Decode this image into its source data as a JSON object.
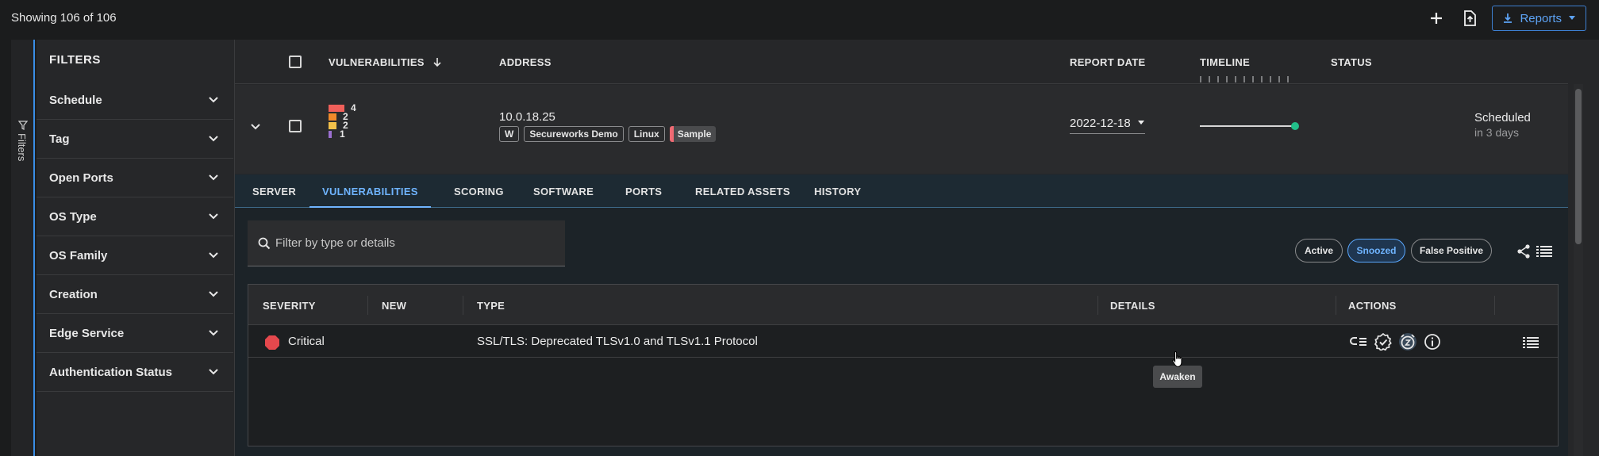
{
  "header": {
    "showing": "Showing 106 of 106",
    "reports_label": "Reports",
    "add_icon": "plus-icon",
    "upload_icon": "file-upload-icon"
  },
  "filter_rail": {
    "label": "Filters"
  },
  "filters": {
    "title": "FILTERS",
    "items": [
      {
        "label": "Schedule"
      },
      {
        "label": "Tag"
      },
      {
        "label": "Open Ports"
      },
      {
        "label": "OS Type"
      },
      {
        "label": "OS Family"
      },
      {
        "label": "Creation"
      },
      {
        "label": "Edge Service"
      },
      {
        "label": "Authentication Status"
      }
    ]
  },
  "table": {
    "columns": {
      "vulnerabilities": "VULNERABILITIES",
      "address": "ADDRESS",
      "report_date": "REPORT DATE",
      "timeline": "TIMELINE",
      "status": "STATUS"
    },
    "row": {
      "severity_counts": [
        {
          "count": "4",
          "color": "#f0605a",
          "width": 20
        },
        {
          "count": "2",
          "color": "#f08a2a",
          "width": 10
        },
        {
          "count": "2",
          "color": "#f2c14a",
          "width": 10
        },
        {
          "count": "1",
          "color": "#9b6fd0",
          "width": 4
        }
      ],
      "address": "10.0.18.25",
      "tags": [
        "W",
        "Secureworks Demo",
        "Linux",
        "Sample"
      ],
      "report_date": "2022-12-18",
      "status": "Scheduled",
      "status_sub": "in 3 days",
      "timeline_color": "#22c08a"
    }
  },
  "tabs": {
    "items": [
      "SERVER",
      "VULNERABILITIES",
      "SCORING",
      "SOFTWARE",
      "PORTS",
      "RELATED ASSETS",
      "HISTORY"
    ],
    "active": "VULNERABILITIES"
  },
  "vuln_panel": {
    "search_placeholder": "Filter by type or details",
    "pills": [
      "Active",
      "Snoozed",
      "False Positive"
    ],
    "active_pill": "Snoozed",
    "columns": {
      "severity": "SEVERITY",
      "new": "NEW",
      "type": "TYPE",
      "details": "DETAILS",
      "actions": "ACTIONS"
    },
    "rows": [
      {
        "severity": "Critical",
        "severity_color": "#e5484d",
        "type": "SSL/TLS: Deprecated TLSv1.0 and TLSv1.1 Protocol",
        "details": ""
      }
    ],
    "actions": [
      "checklist-icon",
      "verified-badge-icon",
      "awaken-alarm-icon",
      "info-icon"
    ],
    "tooltip": "Awaken"
  }
}
